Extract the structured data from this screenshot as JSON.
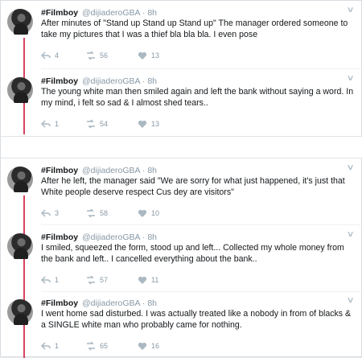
{
  "tweets": [
    {
      "name": "#Filmboy",
      "handle": "@dijiaderoGBA",
      "time": "8h",
      "text": "After minutes of \"Stand up Stand up Stand up\" The manager ordered someone to take my pictures that I was a thief bla bla bla. I even pose",
      "replies": "4",
      "retweets": "56",
      "likes": "13"
    },
    {
      "name": "#Filmboy",
      "handle": "@dijiaderoGBA",
      "time": "8h",
      "text": "The young white man then smiled again and left the bank without saying a word. In my mind, i felt so sad & I almost shed tears..",
      "replies": "1",
      "retweets": "54",
      "likes": "13"
    },
    {
      "name": "#Filmboy",
      "handle": "@dijiaderoGBA",
      "time": "8h",
      "text": "After he left, the manager said \"We are sorry for what just happened, it's just that White people deserve respect Cus dey are visitors\"",
      "replies": "3",
      "retweets": "58",
      "likes": "10"
    },
    {
      "name": "#Filmboy",
      "handle": "@dijiaderoGBA",
      "time": "8h",
      "text": "I smiled, squeezed the form, stood up and left... Collected my whole money from the bank and left.. I cancelled everything about the bank..",
      "replies": "1",
      "retweets": "57",
      "likes": "11"
    },
    {
      "name": "#Filmboy",
      "handle": "@dijiaderoGBA",
      "time": "8h",
      "text": "I went home sad  disturbed. I was actually treated like a nobody in from of blacks & a SINGLE white man who probably came for nothing.",
      "replies": "1",
      "retweets": "65",
      "likes": "16"
    }
  ],
  "icons": {
    "reply": "reply-icon",
    "retweet": "retweet-icon",
    "like": "heart-icon",
    "caret": "chevron-down-icon"
  },
  "colors": {
    "thread_line": "#d7435f",
    "muted_text": "#8899a6"
  }
}
